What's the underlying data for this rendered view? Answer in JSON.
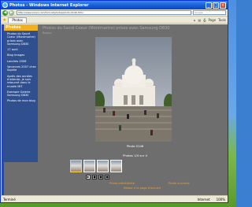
{
  "window": {
    "title": "Photos - Windows Internet Explorer",
    "minimize": "_",
    "maximize": "□",
    "close": "×"
  },
  "addressbar": {
    "url": "http://www.xxxxx.com/tomcat/photos/photo-0146.html",
    "search_placeholder": "Google"
  },
  "tabs": [
    {
      "label": "Photos"
    }
  ],
  "toolbar": [
    "⌂",
    "▤",
    "⎙",
    "Page",
    "Tools"
  ],
  "sidebar": {
    "title": "Photos",
    "items": [
      "Photos du Sacré Coeur (Montmartre) prises avec Samsung D830",
      "17 avril",
      "Blog Images",
      "Londres 2006",
      "Vacances 2007 chez Sophie",
      "Après des années d'attente, je suis retourné dans le musée MIT",
      "Exemple Galerie Samsung D830",
      "Photos de mon blog"
    ]
  },
  "main": {
    "album_title": "Photos du Sacré Coeur (Montmartre) prises avec Samsung D830",
    "back_link": "Retour",
    "photo_name": "Photo 0146",
    "photo_counter": "Photos 1/4 sur 4",
    "prev_label": "Photo précédente",
    "next_label": "Photo suivante",
    "home_label": "Retour à la page d'accueil"
  },
  "controls": [
    "▶",
    "■",
    "■",
    "■"
  ],
  "status": {
    "done": "Terminé",
    "zone": "Internet",
    "zoom": "100%"
  },
  "colors": {
    "sidebar_bg": "#2f4f8f",
    "sidebar_header": "#f0b020",
    "page_bg": "#6e6e6e",
    "link": "#f5a030"
  }
}
